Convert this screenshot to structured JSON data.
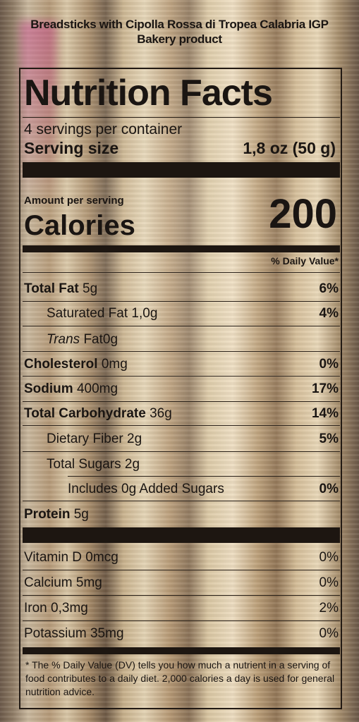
{
  "header": {
    "line1": "Breadsticks with Cipolla Rossa di Tropea Calabria IGP",
    "line2": "Bakery product"
  },
  "label": {
    "title": "Nutrition Facts",
    "servings": "4 servings per container",
    "serving_size_label": "Serving size",
    "serving_size_value": "1,8 oz (50 g)",
    "amount_per_serving": "Amount per serving",
    "calories_label": "Calories",
    "calories_value": "200",
    "dv_header": "% Daily Value*"
  },
  "nutrients": {
    "total_fat": {
      "name": "Total Fat",
      "amount": "5g",
      "dv": "6%"
    },
    "sat_fat": {
      "name": "Saturated Fat",
      "amount": "1,0g",
      "dv": "4%"
    },
    "trans_fat": {
      "name": "Trans",
      "suffix": "Fat",
      "amount": "0g"
    },
    "cholesterol": {
      "name": "Cholesterol",
      "amount": "0mg",
      "dv": "0%"
    },
    "sodium": {
      "name": "Sodium",
      "amount": "400mg",
      "dv": "17%"
    },
    "carb": {
      "name": "Total Carbohydrate",
      "amount": "36g",
      "dv": "14%"
    },
    "fiber": {
      "name": "Dietary Fiber",
      "amount": "2g",
      "dv": "5%"
    },
    "sugars": {
      "name": "Total Sugars",
      "amount": "2g"
    },
    "added_sugars": {
      "name": "Includes 0g Added Sugars",
      "dv": "0%"
    },
    "protein": {
      "name": "Protein",
      "amount": "5g"
    }
  },
  "vitamins": {
    "vit_d": {
      "name": "Vitamin D",
      "amount": "0mcg",
      "dv": "0%"
    },
    "calcium": {
      "name": "Calcium",
      "amount": "5mg",
      "dv": "0%"
    },
    "iron": {
      "name": "Iron",
      "amount": "0,3mg",
      "dv": "2%"
    },
    "potassium": {
      "name": "Potassium",
      "amount": "35mg",
      "dv": "0%"
    }
  },
  "footnote": "* The % Daily Value (DV) tells you how much a nutrient in a serving of food contributes to a daily diet. 2,000 calories a day is used for general nutrition advice."
}
